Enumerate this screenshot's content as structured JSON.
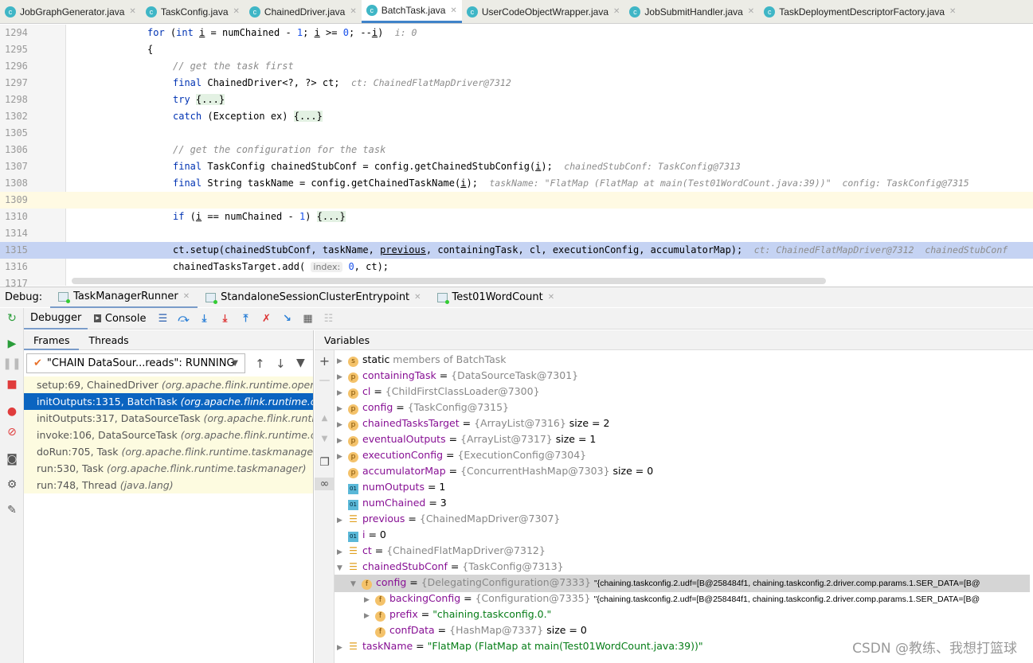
{
  "tabs": [
    {
      "label": "JobGraphGenerator.java"
    },
    {
      "label": "TaskConfig.java"
    },
    {
      "label": "ChainedDriver.java"
    },
    {
      "label": "BatchTask.java",
      "active": true
    },
    {
      "label": "UserCodeObjectWrapper.java"
    },
    {
      "label": "JobSubmitHandler.java"
    },
    {
      "label": "TaskDeploymentDescriptorFactory.java"
    }
  ],
  "editor": {
    "lines": [
      {
        "n": "1294",
        "html": "<span class=kw>for</span> (<span class=kw>int</span> <span class=ul>i</span> = numChained - <span class=num>1</span>; <span class=ul>i</span> &gt;= <span class=num>0</span>; --<span class=ul>i</span>)  <span class=hint>i: 0</span>",
        "indent": 0
      },
      {
        "n": "1295",
        "html": "{",
        "indent": 0
      },
      {
        "n": "1296",
        "html": "<span class=cm>// get the task first</span>",
        "indent": 1
      },
      {
        "n": "1297",
        "html": "<span class=kw>final</span> ChainedDriver&lt;?, ?&gt; ct;  <span class=hint>ct: ChainedFlatMapDriver@7312</span>",
        "indent": 1
      },
      {
        "n": "1298",
        "html": "<span class=kw>try</span> <span class=fold>{...}</span>",
        "indent": 1
      },
      {
        "n": "1302",
        "html": "<span class=kw>catch</span> (Exception ex) <span class=fold>{...}</span>",
        "indent": 1
      },
      {
        "n": "1305",
        "html": "",
        "indent": 1
      },
      {
        "n": "1306",
        "html": "<span class=cm>// get the configuration for the task</span>",
        "indent": 1
      },
      {
        "n": "1307",
        "html": "<span class=kw>final</span> TaskConfig chainedStubConf = config.getChainedStubConfig(<span class=ul>i</span>);  <span class=hint>chainedStubConf: TaskConfig@7313</span>",
        "indent": 1
      },
      {
        "n": "1308",
        "html": "<span class=kw>final</span> String taskName = config.getChainedTaskName(<span class=ul>i</span>);  <span class=hint>taskName: \"FlatMap (FlatMap at main(Test01WordCount.java:39))\"  config: TaskConfig@7315</span>",
        "indent": 1
      },
      {
        "n": "1309",
        "html": "",
        "indent": 1,
        "bg": "#fffae3"
      },
      {
        "n": "1310",
        "html": "<span class=kw>if</span> (<span class=ul>i</span> == numChained - <span class=num>1</span>) <span class=fold>{...}</span>",
        "indent": 1
      },
      {
        "n": "1314",
        "html": "",
        "indent": 1
      },
      {
        "n": "1315",
        "html": "ct.setup(chainedStubConf, taskName, <span class=ul>previous</span>, containingTask, cl, executionConfig, accumulatorMap);  <span class=hint>ct: ChainedFlatMapDriver@7312  chainedStubConf</span>",
        "indent": 1,
        "bg": "#c5d3f3"
      },
      {
        "n": "1316",
        "html": "chainedTasksTarget.add( <span class=chip>index:</span> <span class=num>0</span>, ct);",
        "indent": 1
      },
      {
        "n": "1317",
        "html": "",
        "indent": 1
      }
    ]
  },
  "debug": {
    "label": "Debug:",
    "sessions": [
      "TaskManagerRunner",
      "StandaloneSessionClusterEntrypoint",
      "Test01WordCount"
    ],
    "tabs": {
      "debugger": "Debugger",
      "console": "Console"
    },
    "frames_tab": "Frames",
    "threads_tab": "Threads",
    "thread": "\"CHAIN DataSour...reads\": RUNNING",
    "frames": [
      {
        "m": "setup:69, ChainedDriver",
        "p": "(org.apache.flink.runtime.operators"
      },
      {
        "m": "initOutputs:1315, BatchTask",
        "p": "(org.apache.flink.runtime.operators",
        "sel": true
      },
      {
        "m": "initOutputs:317, DataSourceTask",
        "p": "(org.apache.flink.runtime.operators"
      },
      {
        "m": "invoke:106, DataSourceTask",
        "p": "(org.apache.flink.runtime.operators"
      },
      {
        "m": "doRun:705, Task",
        "p": "(org.apache.flink.runtime.taskmanager)"
      },
      {
        "m": "run:530, Task",
        "p": "(org.apache.flink.runtime.taskmanager)"
      },
      {
        "m": "run:748, Thread",
        "p": "(java.lang)"
      }
    ],
    "variables_title": "Variables",
    "vars": [
      {
        "d": 0,
        "a": "r",
        "ic": "s",
        "name": "static",
        "rest": " members of BatchTask",
        "restcls": "ref",
        "loc": true
      },
      {
        "d": 0,
        "a": "r",
        "ic": "p",
        "name": "containingTask",
        "rest": "{DataSourceTask@7301}"
      },
      {
        "d": 0,
        "a": "r",
        "ic": "p",
        "name": "cl",
        "rest": "{ChildFirstClassLoader@7300}"
      },
      {
        "d": 0,
        "a": "r",
        "ic": "p",
        "name": "config",
        "rest": "{TaskConfig@7315}"
      },
      {
        "d": 0,
        "a": "r",
        "ic": "p",
        "name": "chainedTasksTarget",
        "rest": "{ArrayList@7316}",
        "extra": "size = 2"
      },
      {
        "d": 0,
        "a": "r",
        "ic": "p",
        "name": "eventualOutputs",
        "rest": "{ArrayList@7317}",
        "extra": "size = 1"
      },
      {
        "d": 0,
        "a": "r",
        "ic": "p",
        "name": "executionConfig",
        "rest": "{ExecutionConfig@7304}"
      },
      {
        "d": 0,
        "a": "",
        "ic": "p",
        "name": "accumulatorMap",
        "rest": "{ConcurrentHashMap@7303}",
        "extra": "size = 0"
      },
      {
        "d": 0,
        "a": "",
        "ic": "01",
        "name": "numOutputs",
        "val": "1"
      },
      {
        "d": 0,
        "a": "",
        "ic": "01",
        "name": "numChained",
        "val": "3"
      },
      {
        "d": 0,
        "a": "r",
        "ic": "=",
        "name": "previous",
        "rest": "{ChainedMapDriver@7307}"
      },
      {
        "d": 0,
        "a": "",
        "ic": "01",
        "name": "i",
        "val": "0"
      },
      {
        "d": 0,
        "a": "r",
        "ic": "=",
        "name": "ct",
        "rest": "{ChainedFlatMapDriver@7312}"
      },
      {
        "d": 0,
        "a": "d",
        "ic": "=",
        "name": "chainedStubConf",
        "rest": "{TaskConfig@7313}"
      },
      {
        "d": 1,
        "a": "d",
        "ic": "f",
        "name": "config",
        "rest": "{DelegatingConfiguration@7333}",
        "extra": "\"{chaining.taskconfig.2.udf=[B@258484f1, chaining.taskconfig.2.driver.comp.params.1.SER_DATA=[B@",
        "sel": true
      },
      {
        "d": 2,
        "a": "r",
        "ic": "f",
        "name": "backingConfig",
        "rest": "{Configuration@7335}",
        "extra": "\"{chaining.taskconfig.2.udf=[B@258484f1, chaining.taskconfig.2.driver.comp.params.1.SER_DATA=[B@"
      },
      {
        "d": 2,
        "a": "r",
        "ic": "f",
        "name": "prefix",
        "str": "\"chaining.taskconfig.0.\""
      },
      {
        "d": 2,
        "a": "",
        "ic": "f",
        "name": "confData",
        "rest": "{HashMap@7337}",
        "extra": "size = 0"
      },
      {
        "d": 0,
        "a": "r",
        "ic": "=",
        "name": "taskName",
        "str": "\"FlatMap (FlatMap at main(Test01WordCount.java:39))\""
      }
    ]
  },
  "watermark": "CSDN @教练、我想打篮球"
}
